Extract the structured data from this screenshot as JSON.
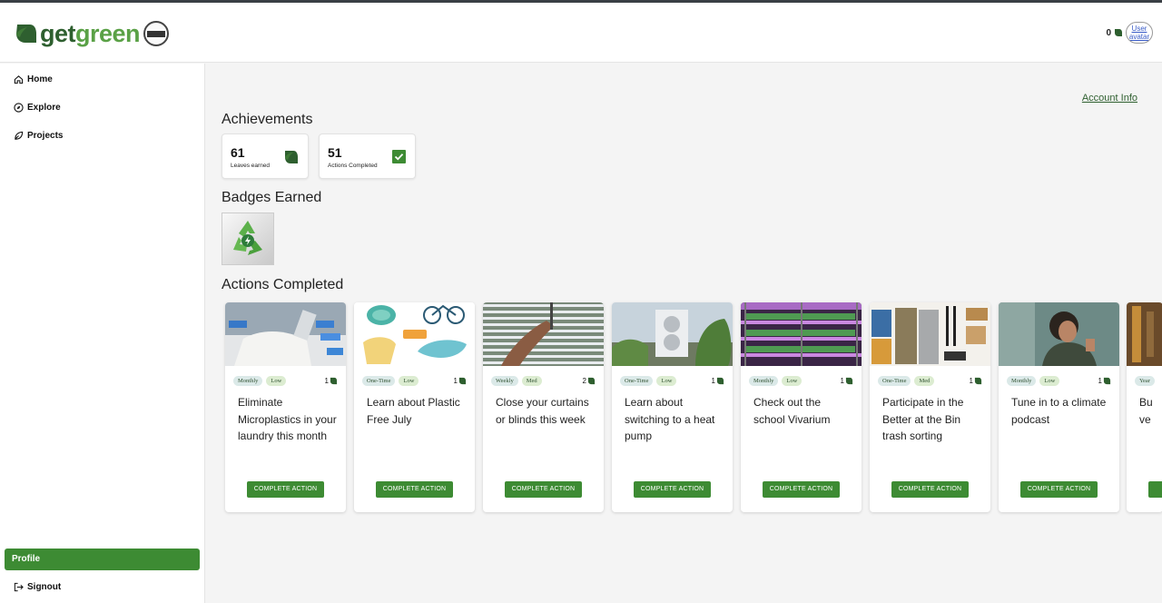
{
  "brand": {
    "get": "get",
    "green": "green"
  },
  "header": {
    "leaf_count": "0",
    "avatar_alt": "User avatar"
  },
  "nav": {
    "home": "Home",
    "explore": "Explore",
    "projects": "Projects",
    "profile": "Profile",
    "signout": "Signout"
  },
  "account_info": "Account Info",
  "achievements": {
    "title": "Achievements",
    "leaves_value": "61",
    "leaves_label": "Leaves earned",
    "actions_value": "51",
    "actions_label": "Actions Completed"
  },
  "badges": {
    "title": "Badges Earned"
  },
  "actions": {
    "title": "Actions Completed",
    "button_label": "COMPLETE ACTION",
    "cards": [
      {
        "frequency": "Monthly",
        "difficulty": "Low",
        "leaves": "1",
        "title": "Eliminate Microplastics in your laundry this month"
      },
      {
        "frequency": "One-Time",
        "difficulty": "Low",
        "leaves": "1",
        "title": "Learn about Plastic Free July"
      },
      {
        "frequency": "Weekly",
        "difficulty": "Med",
        "leaves": "2",
        "title": "Close your curtains or blinds this week"
      },
      {
        "frequency": "One-Time",
        "difficulty": "Low",
        "leaves": "1",
        "title": "Learn about switching to a heat pump"
      },
      {
        "frequency": "Monthly",
        "difficulty": "Low",
        "leaves": "1",
        "title": "Check out the school Vivarium"
      },
      {
        "frequency": "One-Time",
        "difficulty": "Med",
        "leaves": "1",
        "title": "Participate in the Better at the Bin trash sorting"
      },
      {
        "frequency": "Monthly",
        "difficulty": "Low",
        "leaves": "1",
        "title": "Tune in to a climate podcast"
      },
      {
        "frequency": "Year",
        "difficulty": "",
        "leaves": "",
        "title": "Bu ve"
      }
    ]
  },
  "colors": {
    "brand_dark": "#2e5f2f",
    "brand_light": "#5aa146",
    "button": "#3d8b33"
  }
}
